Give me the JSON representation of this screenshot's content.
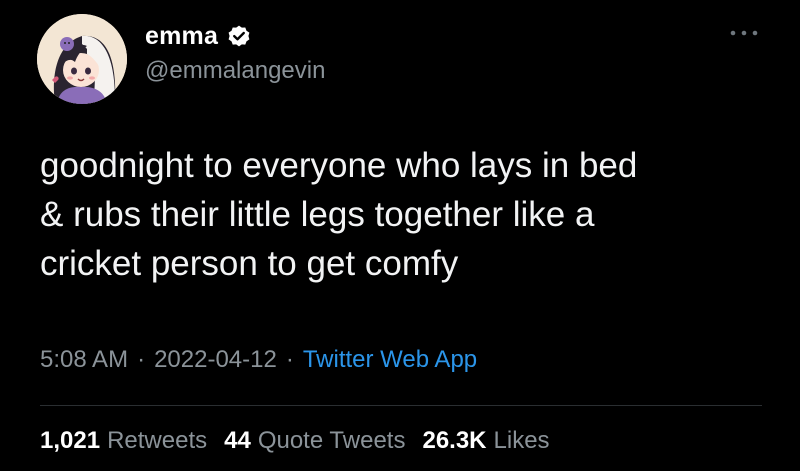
{
  "author": {
    "display_name": "emma",
    "handle": "@emmalangevin",
    "verified_icon": "verified-badge-icon",
    "avatar": "anime-avatar"
  },
  "tweet": {
    "text": "goodnight to everyone who lays in bed\n& rubs their little legs together like a\ncricket person to get comfy"
  },
  "meta": {
    "time": "5:08 AM",
    "separator1": "·",
    "date": "2022-04-12",
    "separator2": "·",
    "source": "Twitter Web App"
  },
  "stats": {
    "retweets_value": "1,021",
    "retweets_label": "Retweets",
    "quotes_value": "44",
    "quotes_label": "Quote Tweets",
    "likes_value": "26.3K",
    "likes_label": "Likes"
  },
  "colors": {
    "background": "#000000",
    "text": "#f2f3f4",
    "muted": "#8b9399",
    "link": "#2b95e9",
    "divider": "#2a2e31"
  },
  "icons": {
    "more": "more-options-icon"
  }
}
